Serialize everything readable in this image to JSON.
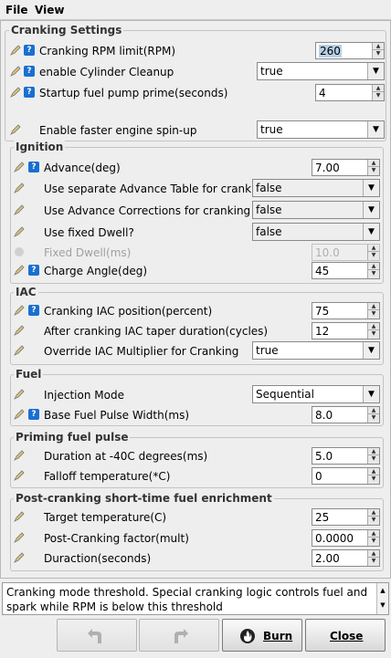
{
  "menu": {
    "file": "File",
    "view": "View"
  },
  "groups": {
    "cranking_settings": "Cranking Settings",
    "ignition": "Ignition",
    "iac": "IAC",
    "fuel": "Fuel",
    "priming": "Priming fuel pulse",
    "post_cranking": "Post-cranking short-time fuel enrichment"
  },
  "cranking": {
    "rpm_limit": {
      "label": "Cranking RPM limit(RPM)",
      "value": "260"
    },
    "cylinder_cleanup": {
      "label": "enable Cylinder Cleanup",
      "value": "true"
    },
    "fuel_pump_prime": {
      "label": "Startup fuel pump prime(seconds)",
      "value": "4"
    },
    "faster_spinup": {
      "label": "Enable faster engine spin-up",
      "value": "true"
    }
  },
  "ignition": {
    "advance": {
      "label": "Advance(deg)",
      "value": "7.00"
    },
    "separate_table": {
      "label": "Use separate Advance Table for cranking",
      "value": "false"
    },
    "advance_corrections": {
      "label": "Use Advance Corrections for cranking",
      "value": "false"
    },
    "fixed_dwell_use": {
      "label": "Use fixed Dwell?",
      "value": "false"
    },
    "fixed_dwell": {
      "label": "Fixed Dwell(ms)",
      "value": "10.0"
    },
    "charge_angle": {
      "label": "Charge Angle(deg)",
      "value": "45"
    }
  },
  "iac": {
    "position": {
      "label": "Cranking IAC position(percent)",
      "value": "75"
    },
    "taper": {
      "label": "After cranking IAC taper duration(cycles)",
      "value": "12"
    },
    "override": {
      "label": "Override IAC Multiplier for Cranking",
      "value": "true"
    }
  },
  "fuel": {
    "injection_mode": {
      "label": "Injection Mode",
      "value": "Sequential"
    },
    "base_pulse": {
      "label": "Base Fuel Pulse Width(ms)",
      "value": "8.0"
    }
  },
  "priming": {
    "duration": {
      "label": "Duration at -40C degrees(ms)",
      "value": "5.0"
    },
    "falloff": {
      "label": "Falloff temperature(*C)",
      "value": "0"
    }
  },
  "post_cranking": {
    "target_temp": {
      "label": "Target temperature(C)",
      "value": "25"
    },
    "factor": {
      "label": "Post-Cranking factor(mult)",
      "value": "0.0000"
    },
    "duration": {
      "label": "Duraction(seconds)",
      "value": "2.00"
    }
  },
  "description": "Cranking mode threshold. Special cranking logic controls fuel and spark while RPM is below this threshold",
  "buttons": {
    "burn": "Burn",
    "close": "Close"
  },
  "icons": {
    "edit": "pencil-edit-icon",
    "help": "help-icon",
    "undo": "undo-icon",
    "redo": "redo-icon",
    "burn": "flame-icon"
  },
  "colors": {
    "help": "#1a6fd0",
    "selection": "#b8cfe5"
  }
}
